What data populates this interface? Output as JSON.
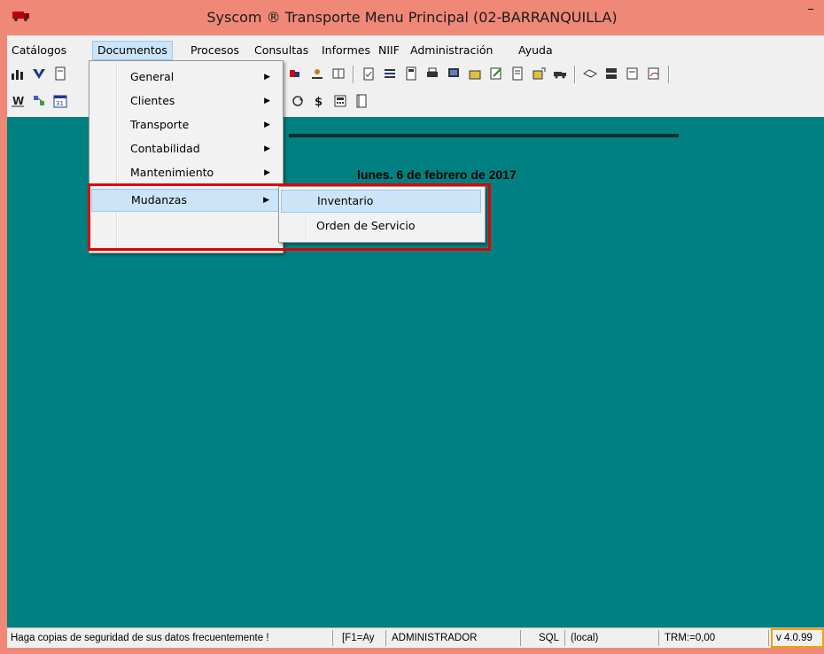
{
  "window": {
    "title": "Syscom ® Transporte Menu Principal (02-BARRANQUILLA)",
    "minimize_glyph": "–",
    "icon": "truck-icon"
  },
  "menubar": {
    "items": [
      "Catálogos",
      "Documentos",
      "Procesos",
      "Consultas",
      "Informes",
      "NIIF",
      "Administración",
      "Ayuda"
    ],
    "active": "Documentos"
  },
  "documentos_menu": {
    "items": [
      {
        "label": "General",
        "has_submenu": true
      },
      {
        "label": "Clientes",
        "has_submenu": true
      },
      {
        "label": "Transporte",
        "has_submenu": true
      },
      {
        "label": "Contabilidad",
        "has_submenu": true
      },
      {
        "label": "Mantenimiento",
        "has_submenu": true
      },
      {
        "label": "Mudanzas",
        "has_submenu": true,
        "highlighted": true
      }
    ],
    "arrow_glyph": "▶"
  },
  "mudanzas_submenu": {
    "items": [
      {
        "label": "Inventario",
        "highlighted": true
      },
      {
        "label": "Orden de Servicio"
      }
    ]
  },
  "main": {
    "date": "lunes. 6 de febrero de 2017",
    "background_color": "#008080"
  },
  "statusbar": {
    "message": "Haga copias de seguridad de sus datos frecuentemente !",
    "help": "[F1=Ay",
    "user": "ADMINISTRADOR",
    "db": "SQL",
    "server": "(local)",
    "trm": "TRM:=0,00",
    "version": "v 4.0.99"
  },
  "colors": {
    "titlebar": "#f08878",
    "highlight_box": "#e00000",
    "version_border": "#f0a000",
    "menu_highlight": "#cce4f7"
  }
}
